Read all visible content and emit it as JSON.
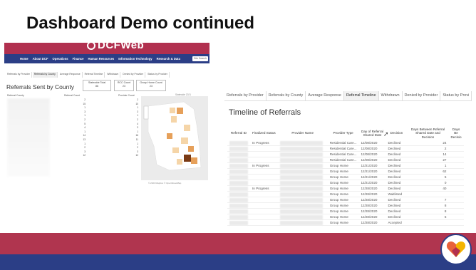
{
  "slide": {
    "title": "Dashboard Demo continued"
  },
  "left_screenshot": {
    "logo_text": "DCFWeb",
    "nav": [
      "Home",
      "About DCF",
      "Operations",
      "Finance",
      "Human Resources",
      "Information Technology",
      "Research & Data"
    ],
    "search_placeholder": "Site Search",
    "tabs": [
      "Referrals by Provider",
      "Referrals by County",
      "Average Response",
      "Referral Timeline",
      "Withdrawn",
      "Denied by Provider",
      "Status by Provider"
    ],
    "active_tab": "Referrals by County",
    "title": "Referrals Sent by County",
    "stats": [
      {
        "label": "Statewide Total",
        "value": "86"
      },
      {
        "label": "RCC Count",
        "value": "23"
      },
      {
        "label": "Group Home Count",
        "value": "23"
      }
    ],
    "columns": {
      "county": "Referral County",
      "referral_count": "Referral Count",
      "provider_count": "Provider Count"
    },
    "referral_counts": [
      "2",
      "15",
      "1",
      "3",
      "1",
      "2",
      "5",
      "4",
      "1",
      "14",
      "13",
      "1",
      "2",
      "3",
      "12"
    ],
    "provider_counts": [
      "2",
      "10",
      "1",
      "3",
      "1",
      "2",
      "4",
      "3",
      "1",
      "16",
      "11",
      "1",
      "2",
      "3",
      "12"
    ],
    "map_title": "Statewide 2021",
    "map_credit": "© 2023 Mapbox © OpenStreetMap",
    "colors": {
      "brand_red": "#b1304f",
      "brand_blue": "#2b3e86",
      "map_light": "#f5d5a8",
      "map_mid": "#e6a05a",
      "map_dark": "#7a3a14"
    }
  },
  "right_screenshot": {
    "tabs": [
      "Referrals by Provider",
      "Referrals by County",
      "Average Response",
      "Referral Timeline",
      "Withdrawn",
      "Denied by Provider",
      "Status by Provi"
    ],
    "active_tab": "Referral Timeline",
    "title": "Timeline of Referrals",
    "columns": [
      "Referral ID",
      "Finalized Status",
      "Provider Name",
      "Provider Type",
      "Day of Referral Shared Date",
      "Decision",
      "Days Between Referral Shared Date and Decision",
      "Days Be Decisio"
    ],
    "rows": [
      {
        "status": "In Progress",
        "type": "Residential Care...",
        "date": "12/08/2020",
        "decision": "Declined",
        "days": "24"
      },
      {
        "status": "",
        "type": "Residential Care...",
        "date": "12/08/2020",
        "decision": "Declined",
        "days": "2"
      },
      {
        "status": "",
        "type": "Residential Care...",
        "date": "12/08/2020",
        "decision": "Declined",
        "days": "14"
      },
      {
        "status": "",
        "type": "Residential Care...",
        "date": "12/08/2020",
        "decision": "Declined",
        "days": "27"
      },
      {
        "status": "In Progress",
        "type": "Group Home",
        "date": "12/21/2020",
        "decision": "Declined",
        "days": "1"
      },
      {
        "status": "",
        "type": "Group Home",
        "date": "12/21/2020",
        "decision": "Declined",
        "days": "62"
      },
      {
        "status": "",
        "type": "Group Home",
        "date": "12/21/2020",
        "decision": "Declined",
        "days": "5"
      },
      {
        "status": "",
        "type": "Group Home",
        "date": "12/21/2020",
        "decision": "Declined",
        "days": "0"
      },
      {
        "status": "In Progress",
        "type": "Group Home",
        "date": "12/28/2020",
        "decision": "Declined",
        "days": "40"
      },
      {
        "status": "",
        "type": "Group Home",
        "date": "12/28/2020",
        "decision": "Waitlisted",
        "days": ""
      },
      {
        "status": "",
        "type": "Group Home",
        "date": "12/28/2020",
        "decision": "Declined",
        "days": "7"
      },
      {
        "status": "",
        "type": "Group Home",
        "date": "12/28/2020",
        "decision": "Declined",
        "days": "8"
      },
      {
        "status": "",
        "type": "Group Home",
        "date": "12/28/2020",
        "decision": "Declined",
        "days": "8"
      },
      {
        "status": "",
        "type": "Group Home",
        "date": "12/28/2020",
        "decision": "Declined",
        "days": "5"
      },
      {
        "status": "",
        "type": "Group Home",
        "date": "12/28/2020",
        "decision": "Accepted",
        "days": ""
      }
    ]
  },
  "footer": {
    "colors": {
      "band": "#b0354f",
      "blue": "#2b3e86"
    }
  }
}
